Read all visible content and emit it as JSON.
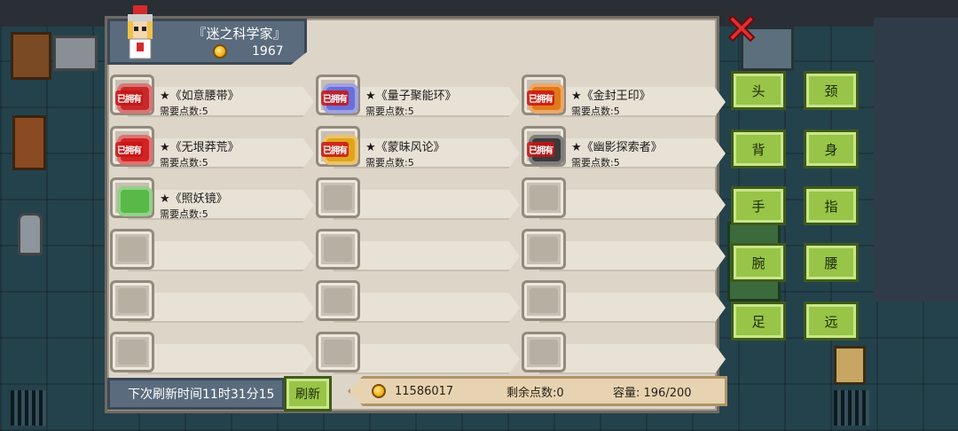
{
  "header": {
    "title": "『迷之科学家』",
    "coins": "1967"
  },
  "items": [
    {
      "name": "★《如意腰带》",
      "cost": "需要点数:5",
      "owned": "已拥有",
      "color": "#c62a2a"
    },
    {
      "name": "★《量子聚能环》",
      "cost": "需要点数:5",
      "owned": "已拥有",
      "color": "#6b6fd8"
    },
    {
      "name": "★《金封王印》",
      "cost": "需要点数:5",
      "owned": "已拥有",
      "color": "#e07a1a"
    },
    {
      "name": "★《无垠莽荒》",
      "cost": "需要点数:5",
      "owned": "已拥有",
      "color": "#d12424"
    },
    {
      "name": "★《蒙昧风论》",
      "cost": "需要点数:5",
      "owned": "已拥有",
      "color": "#e0a31c"
    },
    {
      "name": "★《幽影探索者》",
      "cost": "需要点数:5",
      "owned": "已拥有",
      "color": "#3a3a3a"
    },
    {
      "name": "★《照妖镜》",
      "cost": "需要点数:5",
      "owned": "",
      "color": "#58b848"
    }
  ],
  "categories": [
    "头",
    "颈",
    "背",
    "身",
    "手",
    "指",
    "腕",
    "腰",
    "足",
    "远"
  ],
  "bottom": {
    "refresh_timer": "下次刷新时间11时31分15",
    "refresh_button": "刷新",
    "gold": "11586017",
    "remaining_points": "剩余点数:0",
    "capacity": "容量: 196/200"
  }
}
